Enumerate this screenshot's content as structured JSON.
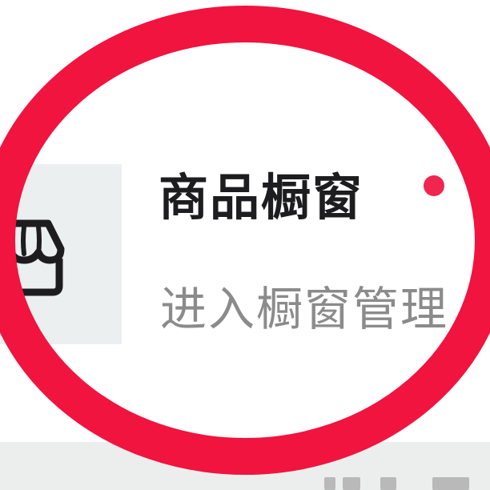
{
  "showcase_entry": {
    "title": "商品橱窗",
    "subtitle": "进入橱窗管理",
    "icon": "storefront-icon",
    "has_new_dot": true
  },
  "annotation": {
    "type": "circle-highlight",
    "color": "#f0143f"
  },
  "colors": {
    "dot": "#f0264f",
    "title": "#1d1d1f",
    "subtitle": "#8b8b8b",
    "icon_tile": "#ecefef"
  }
}
